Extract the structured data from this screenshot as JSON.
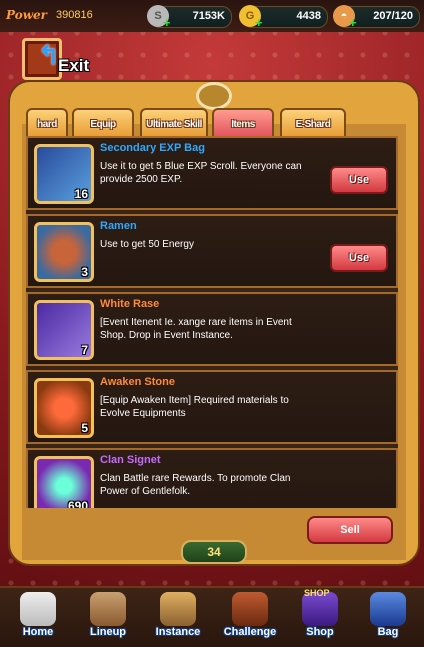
{
  "topbar": {
    "power_label": "Power",
    "power_value": "390816",
    "silver": "7153K",
    "gold": "4438",
    "energy": "207/120"
  },
  "exit_label": "Exit",
  "tabs": [
    {
      "label": "hard"
    },
    {
      "label": "Equip"
    },
    {
      "label": "Ultimate Skill"
    },
    {
      "label": "Items"
    },
    {
      "label": "E-Shard"
    }
  ],
  "items": [
    {
      "name": "Secondary EXP Bag",
      "desc": "Use it to get 5 Blue EXP Scroll. Everyone can provide 2500 EXP.",
      "qty": "16",
      "button": "Use",
      "name_color": "#2fa8ff"
    },
    {
      "name": "Ramen",
      "desc": "Use to get 50 Energy",
      "qty": "3",
      "button": "Use",
      "name_color": "#2fa8ff"
    },
    {
      "name": "White Rase",
      "desc": "[Event Itenent Ie.                  xange rare items in Event Shop. Drop in Event Instance.",
      "qty": "7",
      "button": "",
      "name_color": "#ff8a3a"
    },
    {
      "name": "Awaken Stone",
      "desc": "[Equip Awaken Item] Required materials to Evolve Equipments",
      "qty": "5",
      "button": "",
      "name_color": "#ff8a3a"
    },
    {
      "name": "Clan Signet",
      "desc": "Clan Battle rare Rewards. To promote Clan Power of Gentlefolk.",
      "qty": "690",
      "button": "",
      "name_color": "#c66aff"
    }
  ],
  "sell_label": "Sell",
  "item_count": "34",
  "nav": [
    {
      "label": "Home"
    },
    {
      "label": "Lineup"
    },
    {
      "label": "Instance"
    },
    {
      "label": "Challenge"
    },
    {
      "label": "Shop"
    },
    {
      "label": "Bag"
    }
  ],
  "shop_badge": "SHOP"
}
